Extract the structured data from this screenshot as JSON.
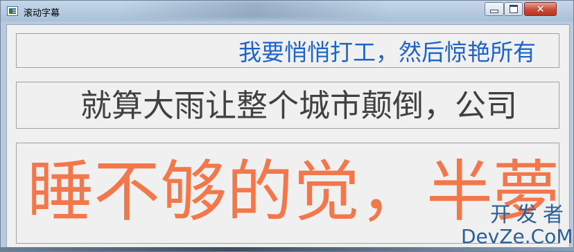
{
  "window": {
    "title": "滚动字幕",
    "controls": {
      "minimize": "minimize",
      "maximize": "maximize",
      "close": "✕"
    }
  },
  "marquees": [
    {
      "text": "我要悄悄打工，然后惊艳所有",
      "color": "#1e63c9"
    },
    {
      "text": "就算大雨让整个城市颠倒，公司",
      "color": "#404040"
    },
    {
      "text": "睡不够的觉，半夢",
      "color": "#f2784b"
    }
  ],
  "watermark": {
    "cn": "开发者",
    "en": "DevZe.CoM"
  }
}
